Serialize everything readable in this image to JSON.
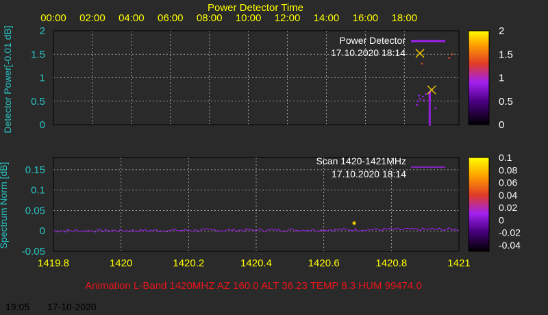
{
  "colors": {
    "background": "#2a2a2a",
    "axis_label": "#29c4c4",
    "top_tick_label": "#ffff00",
    "bottom_tick_label": "#ffff00",
    "footer": "#e8151b",
    "series": "#a020f0",
    "marker": "#ffd700",
    "grid": "#bfbfbf"
  },
  "chart_data": [
    {
      "type": "scatter",
      "title": "Power Detector Time",
      "ylabel": "Detector Power[-0.01 dB]",
      "x_ticks": [
        "00:00",
        "02:00",
        "04:00",
        "06:00",
        "08:00",
        "10:00",
        "12:00",
        "14:00",
        "16:00",
        "18:00"
      ],
      "y_ticks": [
        "0",
        "0.5",
        "1",
        "1.5",
        "2"
      ],
      "ylim": [
        0,
        2
      ],
      "xlim_hours": [
        0,
        20.8
      ],
      "grid": true,
      "legend": {
        "entries": [
          "Power Detector"
        ],
        "date": "17.10.2020 18:14",
        "placement": "top-right"
      },
      "colorbar": {
        "ticks": [
          "0",
          "0.5",
          "1",
          "1.5",
          "2"
        ],
        "range": [
          0,
          2
        ]
      },
      "series": [
        {
          "name": "Power Detector",
          "x_hours": [
            19.3,
            19.3,
            19.3,
            19.3,
            19.3,
            19.3,
            19.3,
            19.3,
            19.3,
            19.3,
            19.3,
            19.3,
            19.3,
            19.3,
            19.3,
            19.3,
            19.3,
            19.3,
            19.3,
            19.3
          ],
          "y": [
            0.0,
            0.05,
            0.1,
            0.15,
            0.2,
            0.25,
            0.3,
            0.35,
            0.4,
            0.45,
            0.5,
            0.52,
            0.55,
            0.58,
            0.6,
            0.62,
            0.64,
            0.66,
            0.68,
            0.7
          ]
        }
      ],
      "scatter_points": [
        {
          "x": 18.65,
          "y": 0.42
        },
        {
          "x": 18.7,
          "y": 0.5
        },
        {
          "x": 18.8,
          "y": 0.55
        },
        {
          "x": 18.95,
          "y": 0.6
        },
        {
          "x": 19.0,
          "y": 0.52
        },
        {
          "x": 18.75,
          "y": 0.62
        },
        {
          "x": 19.1,
          "y": 0.65
        },
        {
          "x": 19.6,
          "y": 0.35
        },
        {
          "x": 18.9,
          "y": 1.3
        },
        {
          "x": 20.3,
          "y": 1.42
        },
        {
          "x": 20.45,
          "y": 1.5
        }
      ],
      "markers": [
        {
          "x": 18.8,
          "y": 1.52
        },
        {
          "x": 19.4,
          "y": 0.74
        }
      ]
    },
    {
      "type": "line",
      "title": "",
      "xlabel": "",
      "ylabel": "Spectrum Norm [dB]",
      "x_ticks": [
        "1419.8",
        "1420",
        "1420.2",
        "1420.4",
        "1420.6",
        "1420.8",
        "1421"
      ],
      "y_ticks": [
        "-0.05",
        "0",
        "0.05",
        "0.1",
        "0.15"
      ],
      "xlim": [
        1419.8,
        1421
      ],
      "ylim": [
        -0.05,
        0.18
      ],
      "grid": true,
      "legend": {
        "entries": [
          "Scan 1420-1421MHz"
        ],
        "date": "17.10.2020 18:14",
        "placement": "top-right"
      },
      "colorbar": {
        "ticks": [
          "0.1",
          "0.08",
          "0.06",
          "0.04",
          "0.02",
          "0",
          "-0.02",
          "-0.04"
        ],
        "range": [
          -0.05,
          0.1
        ]
      },
      "series": [
        {
          "name": "Scan 1420-1421MHz",
          "x_start": 1419.8,
          "x_end": 1421,
          "points": 200,
          "baseline": 0.0,
          "noise": 0.004
        }
      ],
      "markers": [
        {
          "x": 1420.69,
          "y": 0.019
        }
      ]
    }
  ],
  "footer": {
    "caption": "Animation L-Band 1420MHZ AZ 160.0 ALT 36.23 TEMP 8.3 HUM 99474.0"
  },
  "status": {
    "time": "19:05",
    "date": "17-10-2020"
  }
}
